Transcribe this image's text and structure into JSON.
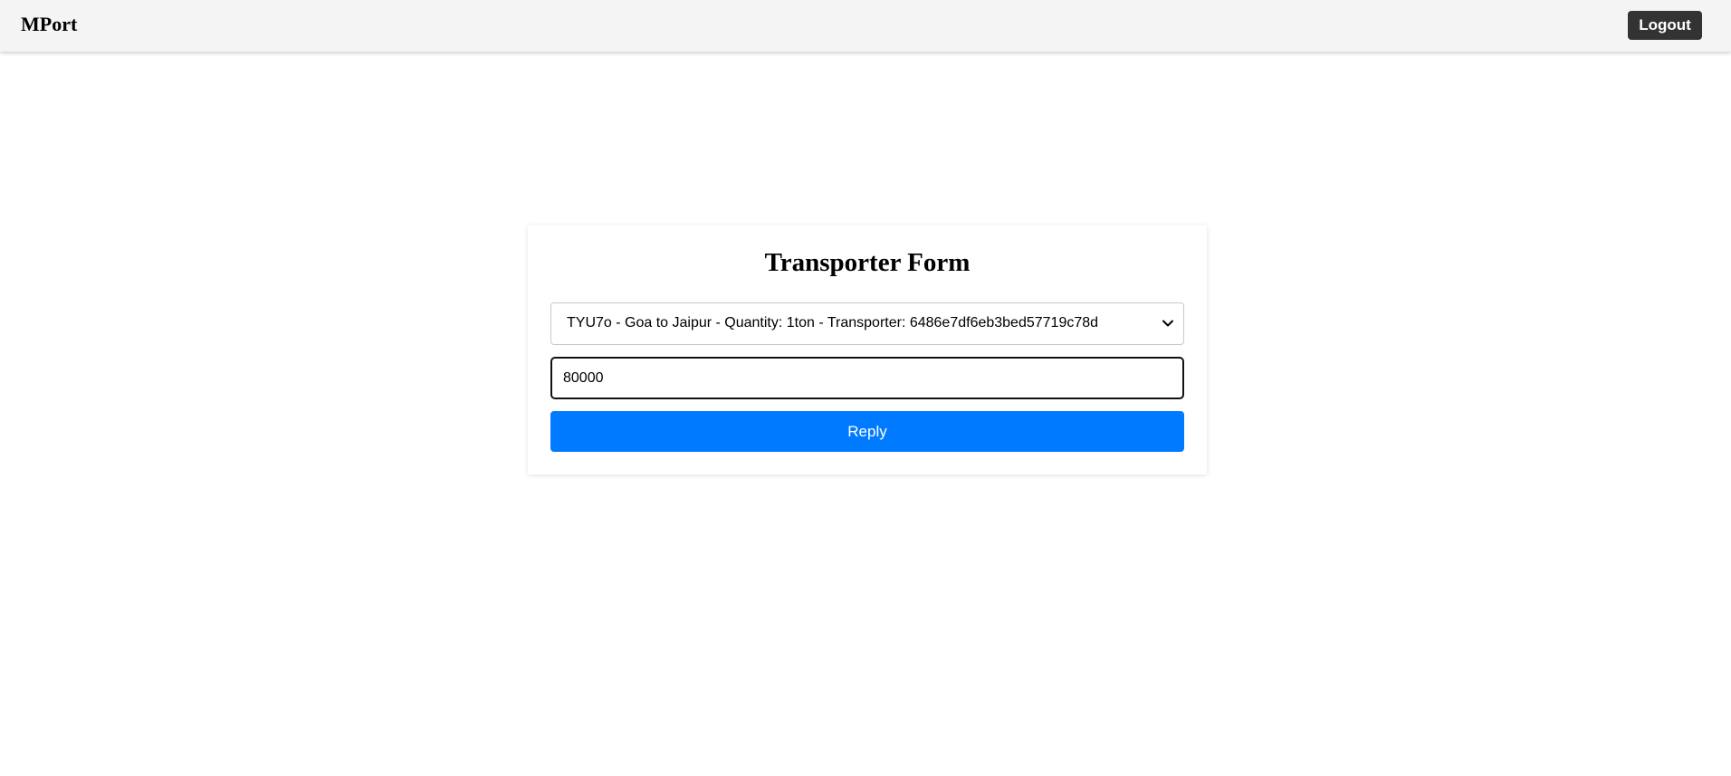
{
  "header": {
    "brand": "MPort",
    "logout_label": "Logout"
  },
  "form": {
    "title": "Transporter Form",
    "select": {
      "selected": "TYU7o - Goa to Jaipur - Quantity: 1ton - Transporter: 6486e7df6eb3bed57719c78d",
      "icon": "chevron-down-icon"
    },
    "amount": {
      "value": "80000"
    },
    "reply_label": "Reply"
  },
  "colors": {
    "topbar_bg": "#f4f4f4",
    "logout_bg": "#333333",
    "primary": "#007bff"
  }
}
